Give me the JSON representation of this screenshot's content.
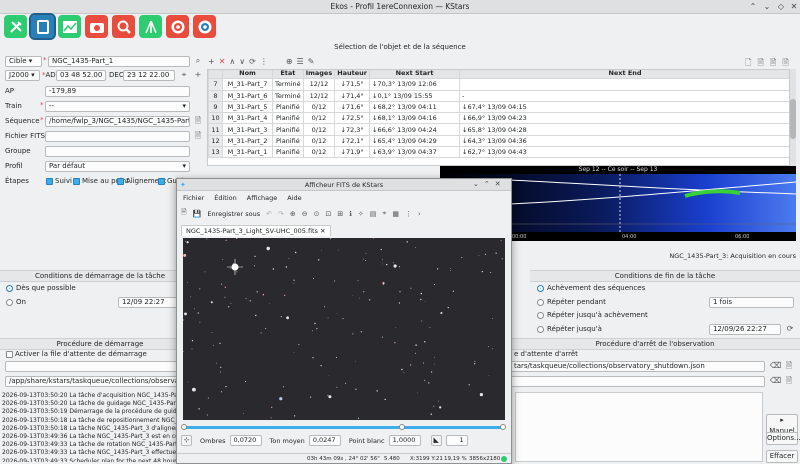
{
  "window": {
    "title": "Ekos - Profil 1ereConnexion — KStars"
  },
  "header": {
    "section_title": "Sélection de l'objet et de la séquence"
  },
  "form": {
    "target_combo": "Cible",
    "target_value": "NGC_1435-Part_1",
    "epoch": "J2000",
    "ad_label": "AD",
    "ad_value": "03 48 52.00",
    "dec_label": "DEC",
    "dec_value": "23 12 22.00",
    "ap_label": "AP",
    "ap_value": "-179,89",
    "train_label": "Train",
    "train_value": "--",
    "sequence_label": "Séquence",
    "sequence_value": "/home/fwlp_3/NGC_1435/NGC_1435-Part_1.esq",
    "fits_label": "Fichier FITS",
    "group_label": "Groupe",
    "profile_label": "Profil",
    "profile_value": "Par défaut",
    "steps_label": "Étapes",
    "step_track": "Suivi",
    "step_focus": "Mise au point",
    "step_align": "Alignement",
    "step_guide": "Guid"
  },
  "table": {
    "columns": [
      "",
      "Nom",
      "État",
      "Images",
      "Hauteur",
      "Next Start",
      "Next End"
    ],
    "rows": [
      [
        "7",
        "M_31-Part_7",
        "Terminé",
        "12/12",
        "↓71,5°",
        "↓70,3° 13/09 12:06",
        ""
      ],
      [
        "8",
        "M_31-Part_6",
        "Terminé",
        "12/12",
        "↓71,4°",
        "↓0,1° 13/09 15:55",
        "-"
      ],
      [
        "9",
        "M_31-Part_5",
        "Planifié",
        "0/12",
        "↓71,6°",
        "↓68,2° 13/09 04:11",
        "↓67,4° 13/09 04:15"
      ],
      [
        "10",
        "M_31-Part_4",
        "Planifié",
        "0/12",
        "↓72,5°",
        "↓68,1° 13/09 04:16",
        "↓66,9° 13/09 04:23"
      ],
      [
        "11",
        "M_31-Part_3",
        "Planifié",
        "0/12",
        "↓72,3°",
        "↓66,6° 13/09 04:24",
        "↓65,8° 13/09 04:28"
      ],
      [
        "12",
        "M_31-Part_2",
        "Planifié",
        "0/12",
        "↓72,1°",
        "↓65,4° 13/09 04:29",
        "↓64,3° 13/09 04:36"
      ],
      [
        "13",
        "M_31-Part_1",
        "Planifié",
        "0/12",
        "↓71,9°",
        "↓63,9° 13/09 04:37",
        "↓62,7° 13/09 04:43"
      ]
    ]
  },
  "graph": {
    "title": "Sep 12 -- Ce soir -- Sep 13",
    "tick1": "00:00",
    "tick2": "04:00",
    "tick3": "06:00",
    "footer": "NGC_1435-Part_3: Acquisition en cours"
  },
  "startup": {
    "title": "Conditions de démarrage de la tâche",
    "asap": "Dès que possible",
    "on": "On",
    "on_date": "12/09 22:27",
    "procedure_title": "Procédure de démarrage",
    "activate_label": "Activer la file d'attente de démarrage",
    "script_path": "/app/share/kstars/taskqueue/collections/observatory_startup.pos"
  },
  "end": {
    "title": "Conditions de fin de la tâche",
    "opt1": "Achèvement des séquences",
    "opt2": "Répéter pendant",
    "opt2_value": "1 fois",
    "opt3": "Répéter jusqu'à achèvement",
    "opt4": "Répéter jusqu'à",
    "opt4_value": "12/09/26 22:27",
    "procedure_title": "Procédure d'arrêt de l'observation",
    "queue_label": "e d'attente d'arrêt",
    "script_path": "tars/taskqueue/collections/observatory_shutdown.json"
  },
  "log": [
    "2026-09-13T03:50:20 La tâche d'acquisition NGC_1435-Part_3 est en",
    "2026-09-13T03:50:20 La tâche de guidage NGC_1435-Part_3 est en c",
    "2026-09-13T03:50:19 Démarrage de la procédure de guidage pour N",
    "2026-09-13T03:50:18 La tâche de repositionnement NGC_1435-Part_3",
    "2026-09-13T03:50:18 La tâche NGC_1435-Part_3 d'alignement est te",
    "2026-09-13T03:49:36 La tâche NGC_1435-Part_3 est en cours d'acqui",
    "2026-09-13T03:49:33 La tâche de rotation NGC_1435-Part_3 est tern",
    "2026-09-13T03:49:33 La tâche NGC_1435-Part_3 effectue la rotation",
    "2026-09-13T03:49:33 Scheduler plan for the next 48 hours starting"
  ],
  "buttons": {
    "manual": "Manuel",
    "options": "Options...",
    "clear": "Effacer"
  },
  "fits": {
    "title": "Afficheur FITS de KStars",
    "menu": [
      "Fichier",
      "Édition",
      "Affichage",
      "Aide"
    ],
    "save_as": "Enregistrer sous",
    "tab": "NGC_1435-Part_3_Light_SV-UHC_005.fits",
    "shadows_label": "Ombres",
    "shadows_value": "0,0720",
    "midtones_label": "Ton moyen",
    "midtones_value": "0,0247",
    "white_label": "Point blanc",
    "white_value": "1,0000",
    "gamma_value": "1",
    "status": {
      "coords": "03h 43m 09s , 24° 02' 56\"",
      "value": "5.480",
      "xy": "X:3199 Y:21",
      "zoom": "19,19 %",
      "size": "3856x2180"
    }
  },
  "colors": {
    "accent": "#3daee9",
    "sky": "#1a3fcf",
    "green": "#39d039"
  }
}
